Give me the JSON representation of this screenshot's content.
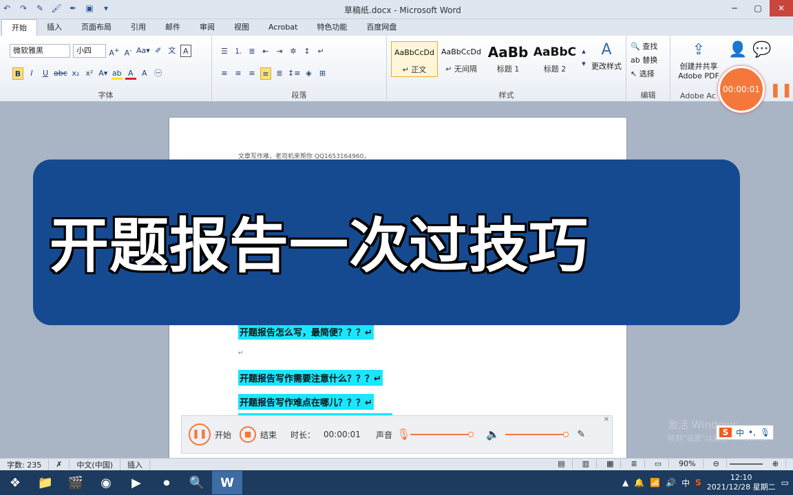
{
  "window": {
    "title": "草稿纸.docx - Microsoft Word"
  },
  "tabs": [
    "开始",
    "插入",
    "页面布局",
    "引用",
    "邮件",
    "审阅",
    "视图",
    "Acrobat",
    "特色功能",
    "百度网盘"
  ],
  "font": {
    "font_name": "微软雅黑",
    "font_size": "小四",
    "group_label": "字体"
  },
  "paragraph": {
    "group_label": "段落"
  },
  "styles": {
    "group_label": "样式",
    "items": [
      {
        "sample": "AaBbCcDd",
        "name": "↵ 正文"
      },
      {
        "sample": "AaBbCcDd",
        "name": "↵ 无间隔"
      },
      {
        "sample": "AaBb",
        "name": "标题 1"
      },
      {
        "sample": "AaBbC",
        "name": "标题 2"
      }
    ],
    "change_styles": "更改样式"
  },
  "editing": {
    "group_label": "编辑",
    "find": "查找",
    "replace": "替换",
    "select": "选择"
  },
  "adobe": {
    "create_label_1": "创建并共享",
    "create_label_2": "Adobe PDF",
    "group_label": "Adobe Ac"
  },
  "document": {
    "top_line": "文章写作难，老司机来帮你   QQ1653164960，",
    "lines": [
      "开题报告怎么写，最简便？？？↵",
      "开题报告写作需要注意什么？？？↵",
      "开题报告写作难点在哪儿？？？↵"
    ]
  },
  "banner": {
    "text": "开题报告一次过技巧"
  },
  "recorder": {
    "timer": "00:00:01",
    "start": "开始",
    "stop": "结束",
    "duration_label": "时长：",
    "duration": "00:00:01",
    "sound_label": "声音"
  },
  "watermark": {
    "line1": "激活 Windows",
    "line2": "转到\"设置\"以激活 Windows。"
  },
  "ime": {
    "lang": "中"
  },
  "statusbar": {
    "word_count": "字数: 235",
    "language": "中文(中国)",
    "insert_mode": "插入",
    "zoom": "90%"
  },
  "taskbar": {
    "time": "12:10",
    "date": "2021/12/28 星期二",
    "tray_ime": "中"
  }
}
